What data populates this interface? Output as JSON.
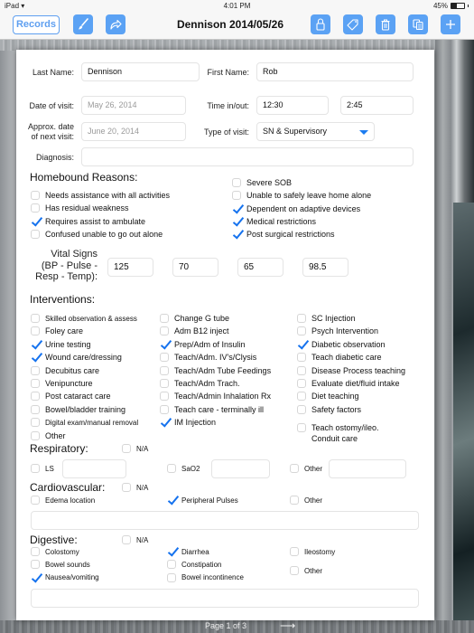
{
  "status_bar": {
    "carrier": "iPad",
    "wifi_icon": "wifi-icon",
    "time": "4:01 PM",
    "battery": "45%",
    "battery_level": 0.45
  },
  "toolbar": {
    "records_label": "Records",
    "title": "Dennison 2014/05/26",
    "left_icons": [
      "paintbrush-icon",
      "share-arrow-icon"
    ],
    "right_icons": [
      "lock-icon",
      "tag-icon",
      "trash-icon",
      "copy-icon",
      "plus-icon"
    ],
    "accent_color": "#5ba2f4"
  },
  "form": {
    "last_name": {
      "label": "Last Name:",
      "value": "Dennison"
    },
    "first_name": {
      "label": "First Name:",
      "value": "Rob"
    },
    "date_of_visit": {
      "label": "Date of visit:",
      "value": "May 26, 2014"
    },
    "time_in_out": {
      "label": "Time in/out:",
      "time_in": "12:30",
      "time_out": "2:45"
    },
    "next_visit": {
      "label_line1": "Approx. date",
      "label_line2": "of next visit:",
      "value": "June 20, 2014"
    },
    "type_of_visit": {
      "label": "Type of visit:",
      "value": "SN & Supervisory"
    },
    "diagnosis": {
      "label": "Diagnosis:",
      "value": ""
    }
  },
  "homebound": {
    "title": "Homebound Reasons:",
    "left": [
      {
        "label": "Needs assistance with all activities",
        "checked": false
      },
      {
        "label": "Has residual weakness",
        "checked": false
      },
      {
        "label": "Requires assist to ambulate",
        "checked": true
      },
      {
        "label": "Confused unable to go out alone",
        "checked": false
      }
    ],
    "right": [
      {
        "label": "Severe SOB",
        "checked": false
      },
      {
        "label": "Unable to safely leave home alone",
        "checked": false
      },
      {
        "label": "Dependent on adaptive devices",
        "checked": true
      },
      {
        "label": "Medical restrictions",
        "checked": true
      },
      {
        "label": "Post surgical restrictions",
        "checked": true
      }
    ]
  },
  "vitals": {
    "label_line1": "Vital Signs",
    "label_line2": "(BP - Pulse -",
    "label_line3": "Resp - Temp):",
    "bp": "125",
    "pulse": "70",
    "resp": "65",
    "temp": "98.5"
  },
  "interventions": {
    "title": "Interventions:",
    "col1": [
      {
        "label": "Skilled observation & assess",
        "checked": false
      },
      {
        "label": "Foley care",
        "checked": false
      },
      {
        "label": "Urine testing",
        "checked": true
      },
      {
        "label": "Wound care/dressing",
        "checked": true
      },
      {
        "label": "Decubitus care",
        "checked": false
      },
      {
        "label": "Venipuncture",
        "checked": false
      },
      {
        "label": "Post cataract care",
        "checked": false
      },
      {
        "label": "Bowel/bladder training",
        "checked": false
      },
      {
        "label": "Digital exam/manual removal",
        "checked": false
      },
      {
        "label": "Other",
        "checked": false
      }
    ],
    "col2": [
      {
        "label": "Change G tube",
        "checked": false
      },
      {
        "label": "Adm B12 inject",
        "checked": false
      },
      {
        "label": "Prep/Adm of Insulin",
        "checked": true
      },
      {
        "label": "Teach/Adm. IV's/Clysis",
        "checked": false
      },
      {
        "label": "Teach/Adm Tube Feedings",
        "checked": false
      },
      {
        "label": "Teach/Adm Trach.",
        "checked": false
      },
      {
        "label": "Teach/Admin Inhalation Rx",
        "checked": false
      },
      {
        "label": "Teach care - terminally ill",
        "checked": false
      },
      {
        "label": "IM Injection",
        "checked": true
      }
    ],
    "col3": [
      {
        "label": "SC Injection",
        "checked": false
      },
      {
        "label": "Psych Intervention",
        "checked": false
      },
      {
        "label": "Diabetic observation",
        "checked": true
      },
      {
        "label": "Teach diabetic care",
        "checked": false
      },
      {
        "label": "Disease Process teaching",
        "checked": false
      },
      {
        "label": "Evaluate diet/fluid intake",
        "checked": false
      },
      {
        "label": "Diet teaching",
        "checked": false
      },
      {
        "label": "Safety factors",
        "checked": false
      }
    ],
    "ostomy": {
      "line1": "Teach ostomy/ileo.",
      "line2": "Conduit care",
      "checked": false
    }
  },
  "respiratory": {
    "title": "Respiratory:",
    "na": {
      "label": "N/A",
      "checked": false
    },
    "ls": {
      "label": "LS",
      "checked": false,
      "value": ""
    },
    "sao2": {
      "label": "SaO2",
      "checked": false,
      "value": ""
    },
    "other": {
      "label": "Other",
      "checked": false,
      "value": ""
    }
  },
  "cardiovascular": {
    "title": "Cardiovascular:",
    "na": {
      "label": "N/A",
      "checked": false
    },
    "items": [
      {
        "label": "Edema location",
        "checked": false
      },
      {
        "label": "Peripheral Pulses",
        "checked": true
      },
      {
        "label": "Other",
        "checked": false
      }
    ],
    "notes": ""
  },
  "digestive": {
    "title": "Digestive:",
    "na": {
      "label": "N/A",
      "checked": false
    },
    "col1": [
      {
        "label": "Colostomy",
        "checked": false
      },
      {
        "label": "Bowel sounds",
        "checked": false
      },
      {
        "label": "Nausea/vomiting",
        "checked": true
      }
    ],
    "col2": [
      {
        "label": "Diarrhea",
        "checked": true
      },
      {
        "label": "Constipation",
        "checked": false
      },
      {
        "label": "Bowel incontinence",
        "checked": false
      }
    ],
    "col3": [
      {
        "label": "Ileostomy",
        "checked": false
      },
      {
        "label": "Other",
        "checked": false
      }
    ],
    "notes": ""
  },
  "pager": {
    "text": "Page 1 of 3",
    "next_icon": "arrow-right-icon"
  }
}
